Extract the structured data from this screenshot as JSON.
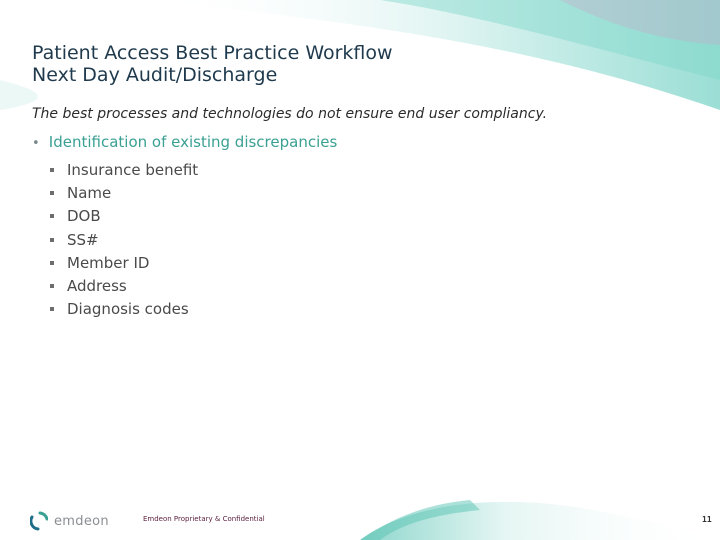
{
  "slide": {
    "title_lines": [
      "Patient Access Best Practice Workflow",
      "Next Day Audit/Discharge"
    ],
    "subtitle": "The best processes and technologies do not ensure end user compliancy.",
    "bullet": "Identification of existing discrepancies",
    "sub_bullets": [
      "Insurance benefit",
      "Name",
      "DOB",
      "SS#",
      "Member ID",
      "Address",
      "Diagnosis codes"
    ]
  },
  "footer": {
    "logo_text": "emdeon",
    "logo_icon": "emdeon-swirl-icon",
    "confidential": "Emdeon Proprietary & Confidential",
    "page_number": "11"
  },
  "colors": {
    "accent": "#3aa093",
    "title": "#1f3a4d",
    "confidential": "#5a1e3e"
  }
}
